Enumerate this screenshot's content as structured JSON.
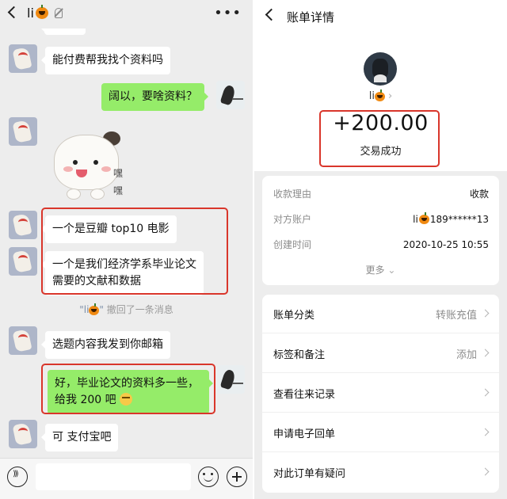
{
  "chat": {
    "title_name": "li",
    "messages": {
      "m1": "能付费帮我找个资料吗",
      "m2": "阔以，要啥资料？",
      "sticker_text": "嘿嘿",
      "m3": "一个是豆瓣 top10 电影",
      "m4_line1": "一个是我们经济学系毕业论文",
      "m4_line2": "需要的文献和数据",
      "recall_name": "\"li",
      "recall_close": "\"",
      "recall_text": "撤回了一条消息",
      "m5": "选题内容我发到你邮箱",
      "m6_line1": "好，毕业论文的资料多一些，",
      "m6_line2": "给我 200 吧",
      "m7": "可 支付宝吧"
    },
    "icons": [
      "back-icon",
      "mute-icon",
      "more-icon",
      "voice-icon",
      "emoji-icon",
      "plus-icon"
    ]
  },
  "bill": {
    "title": "账单详情",
    "name": "li",
    "amount": "+200.00",
    "status": "交易成功",
    "details": {
      "reason_label": "收款理由",
      "reason_value": "收款",
      "account_label": "对方账户",
      "account_name": "li",
      "account_value": "189******13",
      "time_label": "创建时间",
      "time_value": "2020-10-25 10:55",
      "more": "更多"
    },
    "actions": {
      "category_label": "账单分类",
      "category_value": "转账充值",
      "tags_label": "标签和备注",
      "tags_value": "添加",
      "history_label": "查看往来记录",
      "receipt_label": "申请电子回单",
      "dispute_label": "对此订单有疑问"
    }
  },
  "colors": {
    "chat_bg": "#ededed",
    "outgoing_bubble": "#95ec69",
    "highlight_box": "#d9362b"
  }
}
